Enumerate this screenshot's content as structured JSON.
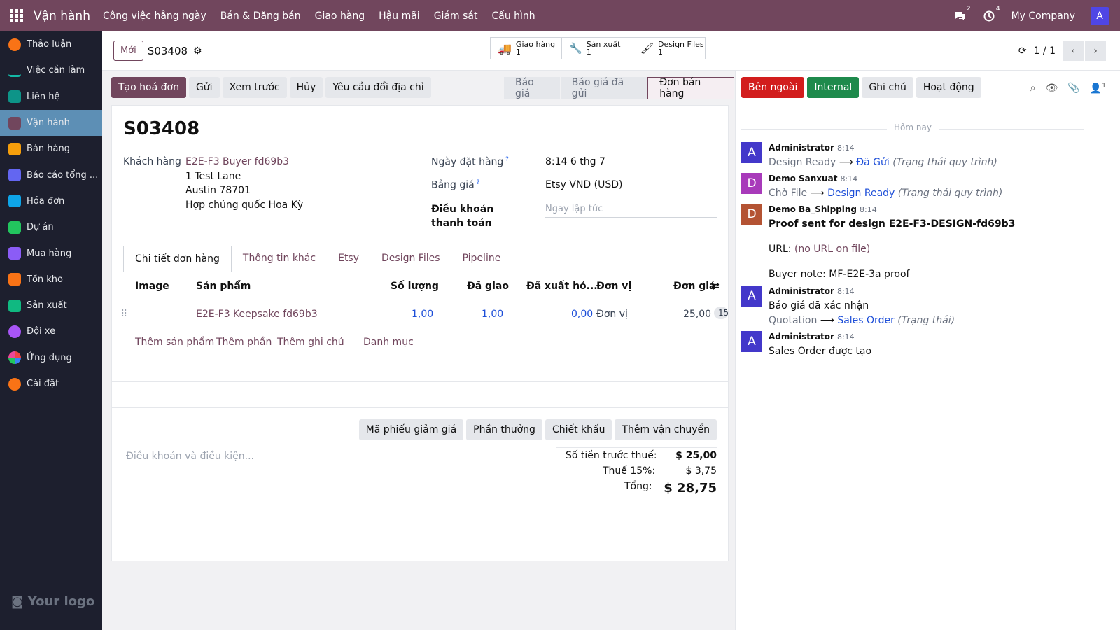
{
  "topbar": {
    "app": "Vận hành",
    "menu": [
      "Công việc hằng ngày",
      "Bán & Đăng bán",
      "Giao hàng",
      "Hậu mãi",
      "Giám sát",
      "Cấu hình"
    ],
    "msg_count": "2",
    "activity_count": "4",
    "company": "My Company",
    "avatar": "A"
  },
  "sidebar": {
    "items": [
      {
        "label": "Thảo luận",
        "color": "#f97316"
      },
      {
        "label": "Việc cần làm",
        "color": "#14b8a6"
      },
      {
        "label": "Liên hệ",
        "color": "#0d9488"
      },
      {
        "label": "Vận hành",
        "color": "#71465d"
      },
      {
        "label": "Bán hàng",
        "color": "#f59e0b"
      },
      {
        "label": "Báo cáo tổng ...",
        "color": "#6366f1"
      },
      {
        "label": "Hóa đơn",
        "color": "#0ea5e9"
      },
      {
        "label": "Dự án",
        "color": "#22c55e"
      },
      {
        "label": "Mua hàng",
        "color": "#8b5cf6"
      },
      {
        "label": "Tồn kho",
        "color": "#f97316"
      },
      {
        "label": "Sản xuất",
        "color": "#10b981"
      },
      {
        "label": "Đội xe",
        "color": "#a855f7"
      },
      {
        "label": "Ứng dụng",
        "color": "#ec4899"
      },
      {
        "label": "Cài đặt",
        "color": "#f97316"
      }
    ],
    "logo": "Your logo"
  },
  "control": {
    "new": "Mới",
    "record": "S03408",
    "smart": [
      {
        "label": "Giao hàng",
        "count": "1"
      },
      {
        "label": "Sản xuất",
        "count": "1"
      },
      {
        "label": "Design Files",
        "count": "1"
      }
    ],
    "pager": "1 / 1"
  },
  "actions": {
    "buttons": [
      "Tạo hoá đơn",
      "Gửi",
      "Xem trước",
      "Hủy",
      "Yêu cầu đổi địa chỉ"
    ],
    "stages": [
      "Báo giá",
      "Báo giá đã gửi",
      "Đơn bán hàng"
    ]
  },
  "form": {
    "title": "S03408",
    "customer_label": "Khách hàng",
    "customer": "E2E-F3 Buyer fd69b3",
    "addr1": "1 Test Lane",
    "addr2": "Austin 78701",
    "addr3": "Hợp chủng quốc Hoa Kỳ",
    "date_label": "Ngày đặt hàng",
    "date": "8:14 6 thg 7",
    "pricelist_label": "Bảng giá",
    "pricelist": "Etsy VND (USD)",
    "terms_label": "Điều khoản thanh toán",
    "terms_placeholder": "Ngay lập tức",
    "tabs": [
      "Chi tiết đơn hàng",
      "Thông tin khác",
      "Etsy",
      "Design Files",
      "Pipeline"
    ],
    "columns": [
      "Image",
      "Sản phẩm",
      "Số lượng",
      "Đã giao",
      "Đã xuất hó...",
      "Đơn vị",
      "Đơn giá"
    ],
    "line": {
      "product": "E2E-F3 Keepsake fd69b3",
      "qty": "1,00",
      "delivered": "1,00",
      "invoiced": "0,00",
      "uom": "Đơn vị",
      "price": "25,00",
      "tax": "15"
    },
    "add": [
      "Thêm sản phẩm",
      "Thêm phần",
      "Thêm ghi chú",
      "Danh mục"
    ],
    "bottom_buttons": [
      "Mã phiếu giảm giá",
      "Phần thưởng",
      "Chiết khấu",
      "Thêm vận chuyển"
    ],
    "terms_cond": "Điều khoản và điều kiện...",
    "untaxed_label": "Số tiền trước thuế:",
    "untaxed": "$ 25,00",
    "tax_label": "Thuế 15%:",
    "tax": "$ 3,75",
    "total_label": "Tổng:",
    "total": "$ 28,75"
  },
  "chatter": {
    "buttons": [
      "Bên ngoài",
      "Internal",
      "Ghi chú",
      "Hoạt động"
    ],
    "followers": "1",
    "today": "Hôm nay",
    "messages": [
      {
        "avatar": "A",
        "color": "#4338ca",
        "author": "Administrator",
        "time": "8:14",
        "from": "Design Ready",
        "to": "Đã Gửi",
        "field": "(Trạng thái quy trình)"
      },
      {
        "avatar": "D",
        "color": "#a83aba",
        "author": "Demo Sanxuat",
        "time": "8:14",
        "from": "Chờ File",
        "to": "Design Ready",
        "field": "(Trạng thái quy trình)"
      },
      {
        "avatar": "D",
        "color": "#b45333",
        "author": "Demo Ba_Shipping",
        "time": "8:14",
        "title": "Proof sent for design E2E-F3-DESIGN-fd69b3",
        "url_label": "URL:",
        "url": "(no URL on file)",
        "note": "Buyer note: MF-E2E-3a proof"
      },
      {
        "avatar": "A",
        "color": "#4338ca",
        "author": "Administrator",
        "time": "8:14",
        "text": "Báo giá đã xác nhận",
        "from": "Quotation",
        "to": "Sales Order",
        "field": "(Trạng thái)"
      },
      {
        "avatar": "A",
        "color": "#4338ca",
        "author": "Administrator",
        "time": "8:14",
        "text": "Sales Order được tạo"
      }
    ]
  }
}
